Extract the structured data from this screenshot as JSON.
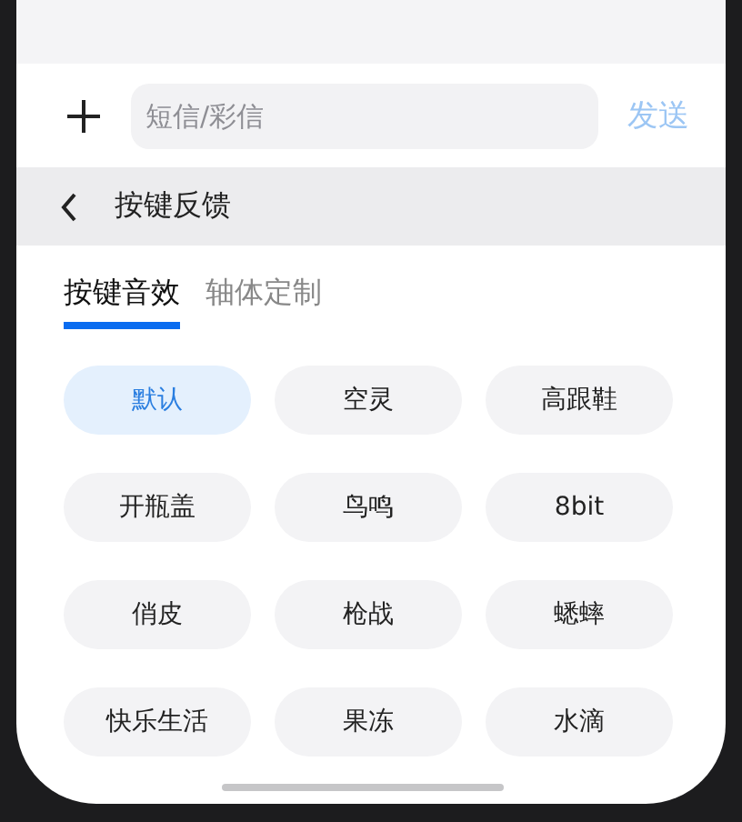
{
  "compose": {
    "placeholder": "短信/彩信",
    "send": "发送"
  },
  "header": {
    "title": "按键反馈"
  },
  "tabs": [
    {
      "label": "按键音效",
      "selected": true
    },
    {
      "label": "轴体定制",
      "selected": false
    }
  ],
  "options": [
    {
      "label": "默认",
      "selected": true
    },
    {
      "label": "空灵",
      "selected": false
    },
    {
      "label": "高跟鞋",
      "selected": false
    },
    {
      "label": "开瓶盖",
      "selected": false
    },
    {
      "label": "鸟鸣",
      "selected": false
    },
    {
      "label": "8bit",
      "selected": false
    },
    {
      "label": "俏皮",
      "selected": false
    },
    {
      "label": "枪战",
      "selected": false
    },
    {
      "label": "蟋蟀",
      "selected": false
    },
    {
      "label": "快乐生活",
      "selected": false
    },
    {
      "label": "果冻",
      "selected": false
    },
    {
      "label": "水滴",
      "selected": false
    }
  ]
}
